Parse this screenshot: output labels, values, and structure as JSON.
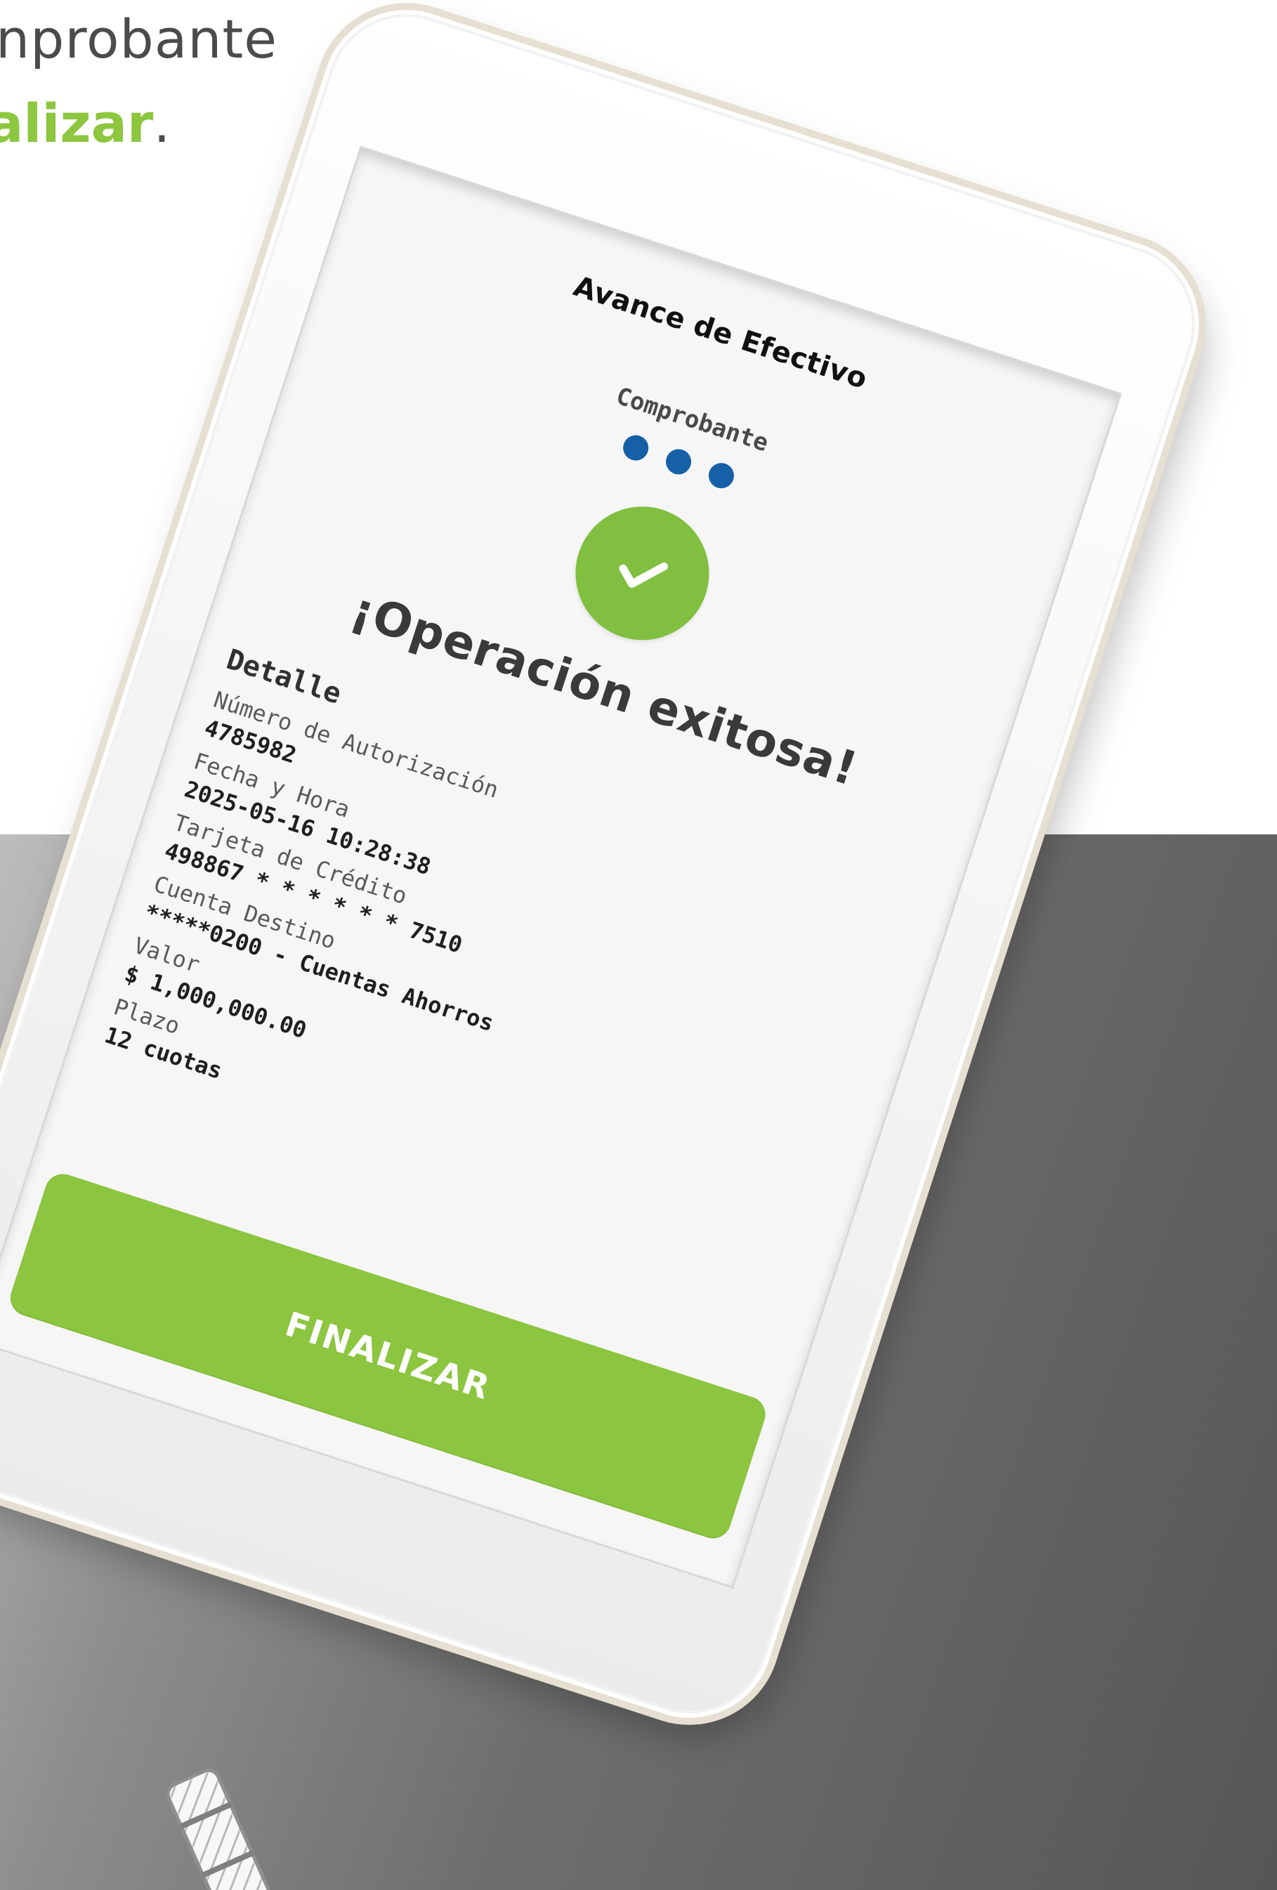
{
  "caption": {
    "top": "nprobante",
    "bottom_prefix": "alizar",
    "bottom_suffix": "."
  },
  "screen": {
    "title": "Avance de Efectivo",
    "step_label": "Comprobante",
    "status_title": "¡Operación exitosa!"
  },
  "details": {
    "title": "Detalle",
    "fields": [
      {
        "label": "Número de Autorización",
        "value": "4785982"
      },
      {
        "label": "Fecha y Hora",
        "value": "2025-05-16 10:28:38"
      },
      {
        "label": "Tarjeta de Crédito",
        "value": "498867 * * * * * * 7510"
      },
      {
        "label": "Cuenta Destino",
        "value": "*****0200 - Cuentas Ahorros"
      },
      {
        "label": "Valor",
        "value": "$ 1,000,000.00"
      },
      {
        "label": "Plazo",
        "value": "12 cuotas"
      }
    ]
  },
  "actions": {
    "finish": "FINALIZAR"
  },
  "icons": {
    "success": "check-icon",
    "progress": "step-dot-icon"
  },
  "colors": {
    "brand_green": "#8cc53f",
    "success_green": "#80bf3f",
    "step_blue": "#1660a8",
    "text_dark": "#222222",
    "background_gray": "#6e6e6e"
  }
}
